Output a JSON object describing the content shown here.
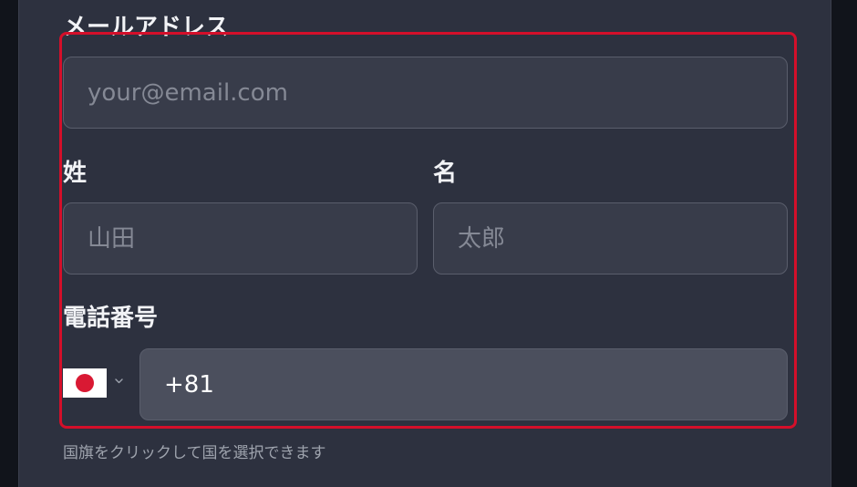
{
  "email": {
    "label": "メールアドレス",
    "placeholder": "your@email.com",
    "value": ""
  },
  "last_name": {
    "label": "姓",
    "placeholder": "山田",
    "value": ""
  },
  "first_name": {
    "label": "名",
    "placeholder": "太郎",
    "value": ""
  },
  "phone": {
    "label": "電話番号",
    "country_icon": "japan-flag-icon",
    "dropdown_icon": "chevron-down-icon",
    "value": "+81",
    "hint": "国旗をクリックして国を選択できます"
  },
  "colors": {
    "highlight": "#d40f2a",
    "background": "#2d313f",
    "input": "#383c4a",
    "phone_input": "#4b4f5d"
  }
}
